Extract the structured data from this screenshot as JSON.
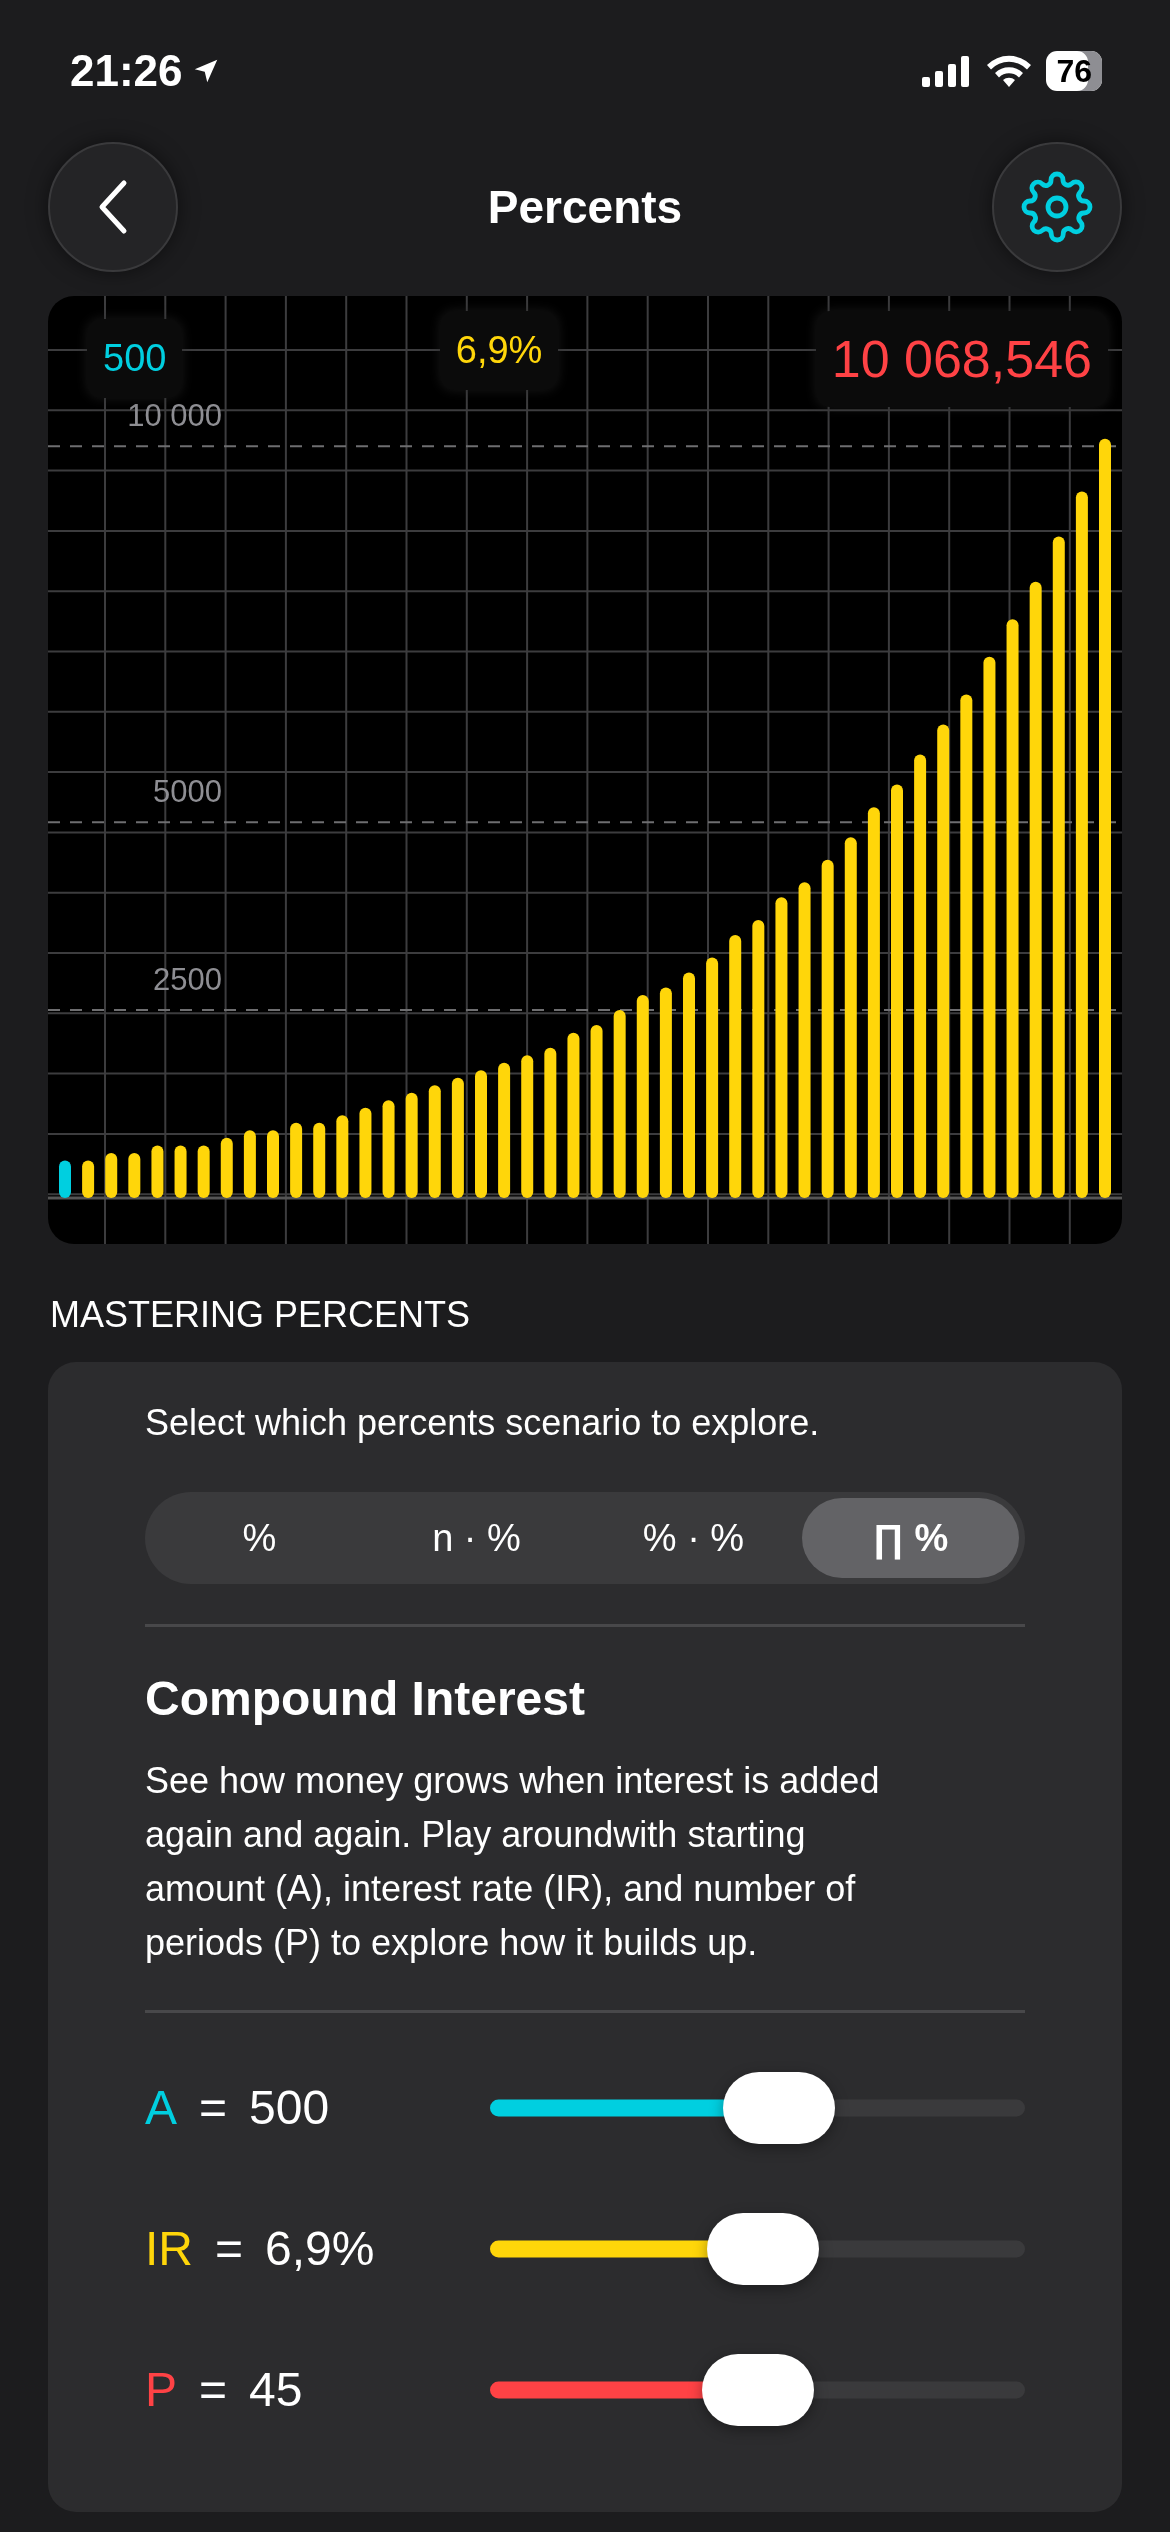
{
  "status_bar": {
    "time": "21:26",
    "battery": "76"
  },
  "header": {
    "title": "Percents"
  },
  "chart": {
    "badges": [
      {
        "text": "500",
        "color": "#00cfe0",
        "kind": "small"
      },
      {
        "text": "6,9%",
        "color": "#ffd60a",
        "kind": "small"
      },
      {
        "text": "10 068,546",
        "color": "#ff4245",
        "kind": "large"
      }
    ],
    "chart_data": {
      "type": "bar",
      "grid": true,
      "ylim": [
        0,
        12000
      ],
      "yticks": [
        {
          "value": 2500,
          "label": "2500"
        },
        {
          "value": 5000,
          "label": "5000"
        },
        {
          "value": 10000,
          "label": "10 000"
        }
      ],
      "series": [
        {
          "color": "#00cfe0",
          "values": [
            500,
            null,
            null,
            null,
            null,
            null,
            null,
            null,
            null,
            null,
            null,
            null,
            null,
            null,
            null,
            null,
            null,
            null,
            null,
            null,
            null,
            null,
            null,
            null,
            null,
            null,
            null,
            null,
            null,
            null,
            null,
            null,
            null,
            null,
            null,
            null,
            null,
            null,
            null,
            null,
            null,
            null,
            null,
            null,
            null,
            null
          ]
        },
        {
          "color": "#ffd60a",
          "values": [
            null,
            500,
            600,
            600,
            700,
            700,
            700,
            800,
            900,
            900,
            1000,
            1000,
            1100,
            1200,
            1300,
            1400,
            1500,
            1600,
            1700,
            1800,
            1900,
            2000,
            2200,
            2300,
            2500,
            2700,
            2800,
            3000,
            3200,
            3500,
            3700,
            4000,
            4200,
            4500,
            4800,
            5200,
            5500,
            5900,
            6300,
            6700,
            7200,
            7700,
            8200,
            8800,
            9400,
            10100
          ]
        }
      ]
    }
  },
  "section_title": "MASTERING PERCENTS",
  "card": {
    "intro": "Select which percents scenario to explore.",
    "segments": [
      {
        "label": "%",
        "selected": false
      },
      {
        "label": "n · %",
        "selected": false
      },
      {
        "label": "% · %",
        "selected": false
      },
      {
        "label": "∏ %",
        "selected": true
      }
    ],
    "title": "Compound Interest",
    "description": "See how money grows when interest is added again and again. Play aroundwith starting amount (A), interest rate (IR), and number of periods (P) to explore how it builds up.",
    "sliders": [
      {
        "symbol": "A",
        "relation": "=",
        "value": "500",
        "color": "#00cfe0",
        "level": 0.54
      },
      {
        "symbol": "IR",
        "relation": "=",
        "value": "6,9%",
        "color": "#ffd60a",
        "level": 0.51
      },
      {
        "symbol": "P",
        "relation": "=",
        "value": "45",
        "color": "#ff4245",
        "level": 0.5
      }
    ]
  }
}
